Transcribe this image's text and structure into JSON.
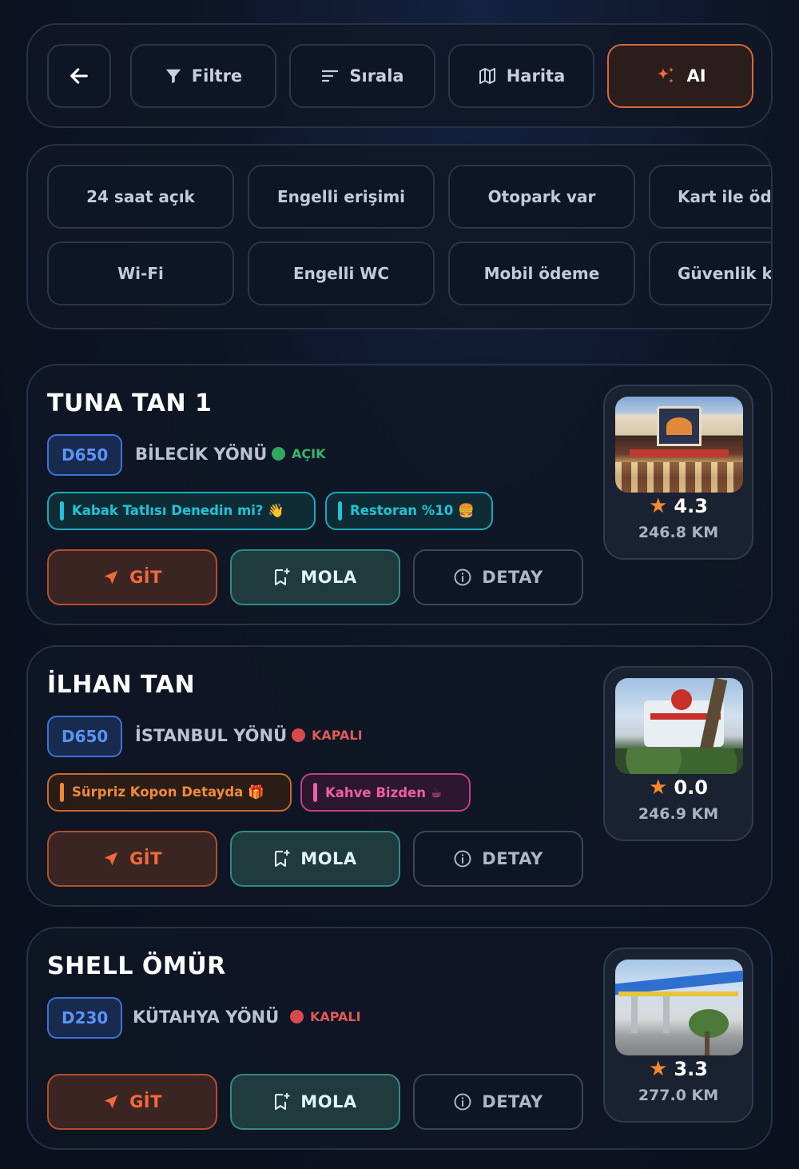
{
  "toolbar": {
    "back_icon": "arrow-left-icon",
    "filter_label": "Filtre",
    "sort_label": "Sırala",
    "map_label": "Harita",
    "ai_label": "AI"
  },
  "chips": {
    "row1": [
      "24 saat açık",
      "Engelli erişimi",
      "Otopark var",
      "Kart ile öde"
    ],
    "row2": [
      "Wi-Fi",
      "Engelli WC",
      "Mobil ödeme",
      "Güvenlik ka"
    ]
  },
  "cards": [
    {
      "title": "TUNA TAN 1",
      "road": "D650",
      "direction": "BİLECİK YÖNÜ",
      "status": "AÇIK",
      "status_kind": "open",
      "tags": [
        {
          "text": "Kabak Tatlısı Denedin mi? 👋",
          "color": "cyan"
        },
        {
          "text": "Restoran %10 🍔",
          "color": "cyan"
        }
      ],
      "rating": "4.3",
      "distance": "246.8 KM",
      "photo_alt": "Tuna Tan storefront"
    },
    {
      "title": "İLHAN TAN",
      "road": "D650",
      "direction": "İSTANBUL YÖNÜ",
      "status": "KAPALI",
      "status_kind": "closed",
      "tags": [
        {
          "text": "Sürpriz Kopon Detayda 🎁",
          "color": "orange"
        },
        {
          "text": "Kahve Bizden ☕",
          "color": "pink"
        }
      ],
      "rating": "0.0",
      "distance": "246.9 KM",
      "photo_alt": "İlhan Tan facility"
    },
    {
      "title": "SHELL ÖMÜR",
      "road": "D230",
      "direction": "KÜTAHYA YÖNÜ",
      "status": "KAPALI",
      "status_kind": "closed",
      "tags": [],
      "rating": "3.3",
      "distance": "277.0 KM",
      "photo_alt": "Shell station"
    }
  ],
  "actions": {
    "go_label": "GİT",
    "mola_label": "MOLA",
    "detail_label": "DETAY"
  },
  "colors": {
    "accent_orange": "#f26a3c",
    "road_blue": "#5a93f6",
    "open_green": "#39b86b",
    "closed_red": "#e05a5a",
    "star": "#f5892f"
  }
}
